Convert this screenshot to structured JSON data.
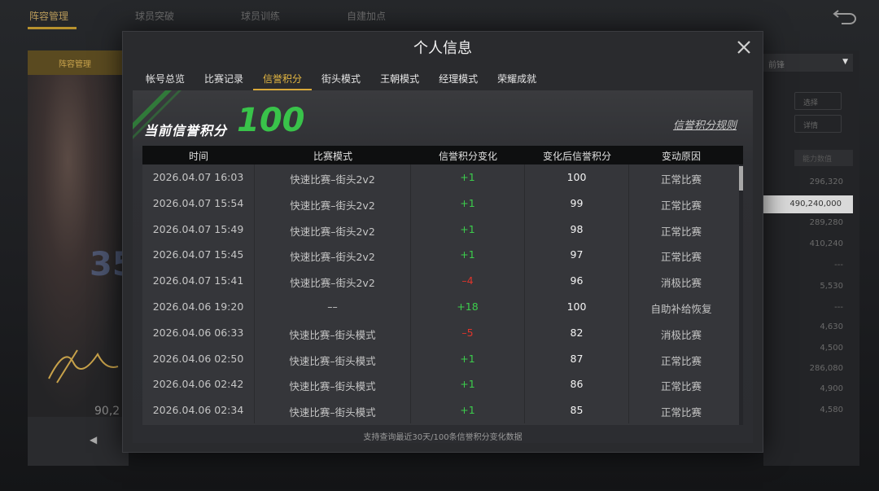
{
  "background": {
    "top_tabs": [
      "阵容管理",
      "球员突破",
      "球员训练",
      "自建加点"
    ],
    "left_panel_header": "阵容管理",
    "player_jersey_number": "35",
    "player_value": "90,2",
    "right_dropdown": "前锋",
    "right_buttons": [
      "选择",
      "详情"
    ],
    "right_column_header": "能力数值",
    "right_values": [
      "296,320",
      "490,240,000",
      "289,280",
      "410,240",
      "---",
      "5,530",
      "---",
      "4,630",
      "4,500",
      "286,080",
      "4,900",
      "4,580"
    ],
    "highlight_index": 1
  },
  "modal": {
    "title": "个人信息",
    "tabs": [
      "帐号总览",
      "比赛记录",
      "信誉积分",
      "街头模式",
      "王朝模式",
      "经理模式",
      "荣耀成就"
    ],
    "active_tab": 2,
    "score_label": "当前信誉积分",
    "score_value": "100",
    "rules_link": "信誉积分规则",
    "columns": [
      "时间",
      "比赛模式",
      "信誉积分变化",
      "变化后信誉积分",
      "变动原因"
    ],
    "rows": [
      {
        "time": "2026.04.07  16:03",
        "mode": "快速比赛–街头2v2",
        "change": "+1",
        "after": "100",
        "reason": "正常比赛",
        "sign": "pos"
      },
      {
        "time": "2026.04.07  15:54",
        "mode": "快速比赛–街头2v2",
        "change": "+1",
        "after": "99",
        "reason": "正常比赛",
        "sign": "pos"
      },
      {
        "time": "2026.04.07  15:49",
        "mode": "快速比赛–街头2v2",
        "change": "+1",
        "after": "98",
        "reason": "正常比赛",
        "sign": "pos"
      },
      {
        "time": "2026.04.07  15:45",
        "mode": "快速比赛–街头2v2",
        "change": "+1",
        "after": "97",
        "reason": "正常比赛",
        "sign": "pos"
      },
      {
        "time": "2026.04.07  15:41",
        "mode": "快速比赛–街头2v2",
        "change": "–4",
        "after": "96",
        "reason": "消极比赛",
        "sign": "neg"
      },
      {
        "time": "2026.04.06  19:20",
        "mode": "––",
        "change": "+18",
        "after": "100",
        "reason": "自助补给恢复",
        "sign": "pos"
      },
      {
        "time": "2026.04.06  06:33",
        "mode": "快速比赛–街头模式",
        "change": "–5",
        "after": "82",
        "reason": "消极比赛",
        "sign": "neg"
      },
      {
        "time": "2026.04.06  02:50",
        "mode": "快速比赛–街头模式",
        "change": "+1",
        "after": "87",
        "reason": "正常比赛",
        "sign": "pos"
      },
      {
        "time": "2026.04.06  02:42",
        "mode": "快速比赛–街头模式",
        "change": "+1",
        "after": "86",
        "reason": "正常比赛",
        "sign": "pos"
      },
      {
        "time": "2026.04.06  02:34",
        "mode": "快速比赛–街头模式",
        "change": "+1",
        "after": "85",
        "reason": "正常比赛",
        "sign": "pos"
      }
    ],
    "footer_note": "支持查询最近30天/100条信誉积分变化数据"
  },
  "colors": {
    "accent_gold": "#d9a93a",
    "positive": "#3ccd4c",
    "negative": "#e0352b",
    "score_green": "#39c34a"
  }
}
